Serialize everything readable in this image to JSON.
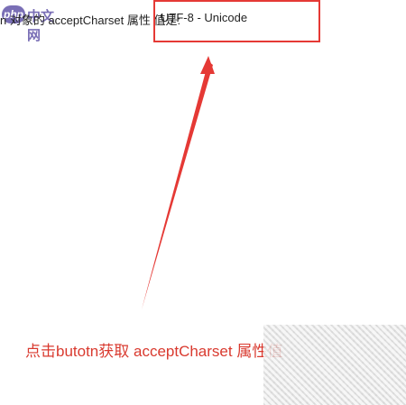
{
  "header": {
    "logo_badge": "php",
    "logo_text": "中文网",
    "prefix_text": "n 对象的 acceptCharset 属性 值是:",
    "value_text": "UTF-8 - Unicode"
  },
  "annotation": {
    "text": "点击butotn获取 acceptCharset 属性值"
  },
  "colors": {
    "highlight": "#e53935",
    "annotation": "#d93a2f",
    "logo": "#7a6fb6"
  }
}
